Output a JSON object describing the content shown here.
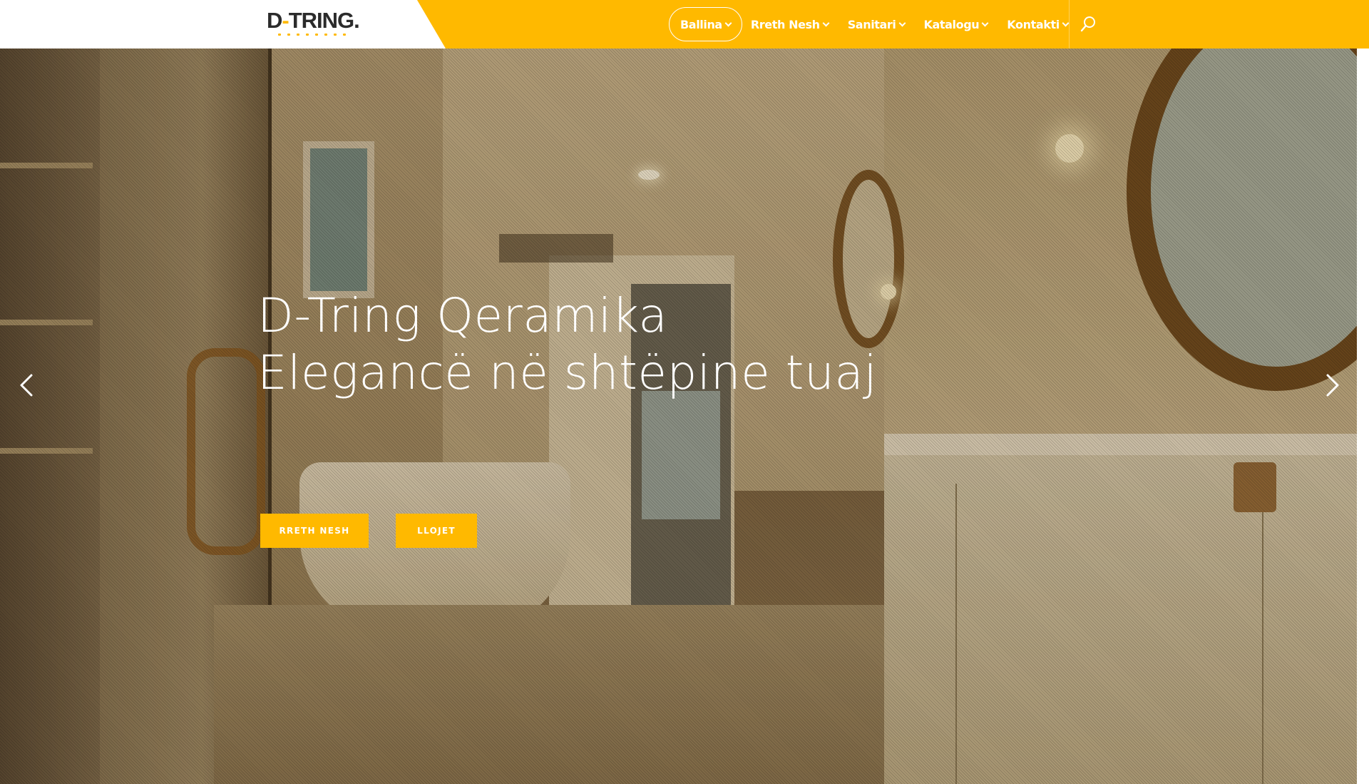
{
  "logo": {
    "text_prefix": "D",
    "text_dash": "-",
    "text_rest": "TRING."
  },
  "nav": {
    "items": [
      {
        "label": "Ballina",
        "active": true
      },
      {
        "label": "Rreth Nesh",
        "active": false
      },
      {
        "label": "Sanitari",
        "active": false
      },
      {
        "label": "Katalogu",
        "active": false
      },
      {
        "label": "Kontakti",
        "active": false
      }
    ],
    "search_icon": "search-icon"
  },
  "hero": {
    "title_line1": "D-Tring Qeramika",
    "title_line2": "Elegancë në shtëpine tuaj",
    "buttons": {
      "about": "RRETH NESH",
      "types": "LLOJET"
    },
    "prev_icon": "chevron-left-icon",
    "next_icon": "chevron-right-icon"
  },
  "colors": {
    "accent": "#ffb900",
    "header_text": "#ffffff",
    "logo_text": "#2b2b2b"
  }
}
